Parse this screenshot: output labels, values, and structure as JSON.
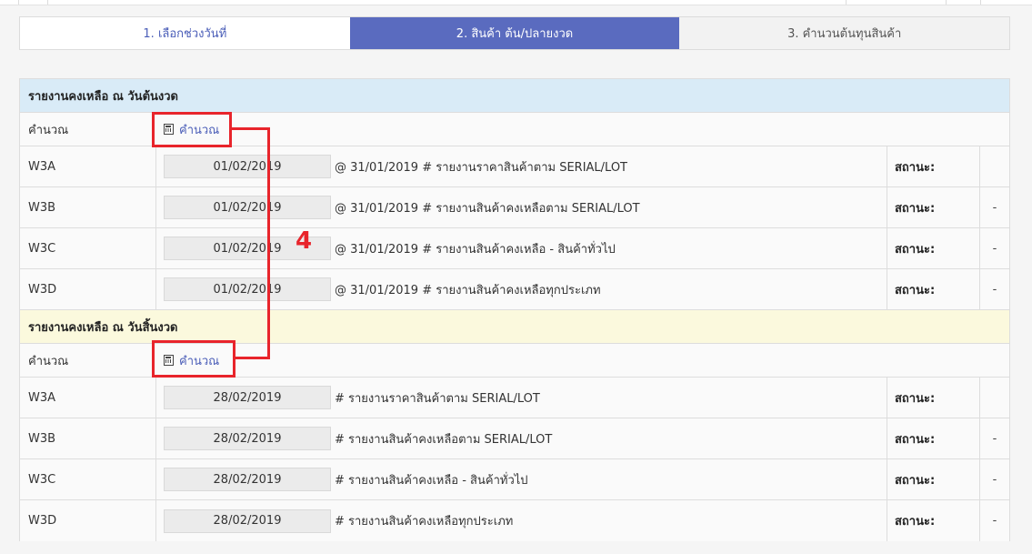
{
  "steps": [
    {
      "label": "1. เลือกช่วงวันที่"
    },
    {
      "label": "2. สินค้า ต้น/ปลายงวด"
    },
    {
      "label": "3. คำนวนต้นทุนสินค้า"
    }
  ],
  "opening": {
    "title": "รายงานคงเหลือ ณ วันต้นงวด",
    "calc_label": "คำนวณ",
    "calc_link": "คำนวณ",
    "rows": [
      {
        "code": "W3A",
        "date": "01/02/2019",
        "desc": "@ 31/01/2019 # รายงานราคาสินค้าตาม SERIAL/LOT",
        "status_label": "สถานะ:",
        "status_value": ""
      },
      {
        "code": "W3B",
        "date": "01/02/2019",
        "desc": "@ 31/01/2019 # รายงานสินค้าคงเหลือตาม SERIAL/LOT",
        "status_label": "สถานะ:",
        "status_value": "-"
      },
      {
        "code": "W3C",
        "date": "01/02/2019",
        "desc": "@ 31/01/2019 # รายงานสินค้าคงเหลือ - สินค้าทั่วไป",
        "status_label": "สถานะ:",
        "status_value": "-"
      },
      {
        "code": "W3D",
        "date": "01/02/2019",
        "desc": "@ 31/01/2019 # รายงานสินค้าคงเหลือทุกประเภท",
        "status_label": "สถานะ:",
        "status_value": "-"
      }
    ]
  },
  "closing": {
    "title": "รายงานคงเหลือ ณ วันสิ้นงวด",
    "calc_label": "คำนวณ",
    "calc_link": "คำนวณ",
    "rows": [
      {
        "code": "W3A",
        "date": "28/02/2019",
        "desc": "# รายงานราคาสินค้าตาม SERIAL/LOT",
        "status_label": "สถานะ:",
        "status_value": ""
      },
      {
        "code": "W3B",
        "date": "28/02/2019",
        "desc": "# รายงานสินค้าคงเหลือตาม SERIAL/LOT",
        "status_label": "สถานะ:",
        "status_value": "-"
      },
      {
        "code": "W3C",
        "date": "28/02/2019",
        "desc": "# รายงานสินค้าคงเหลือ - สินค้าทั่วไป",
        "status_label": "สถานะ:",
        "status_value": "-"
      },
      {
        "code": "W3D",
        "date": "28/02/2019",
        "desc": "# รายงานสินค้าคงเหลือทุกประเภท",
        "status_label": "สถานะ:",
        "status_value": "-"
      }
    ]
  },
  "annotation": {
    "number": "4",
    "color": "#e8242b"
  }
}
